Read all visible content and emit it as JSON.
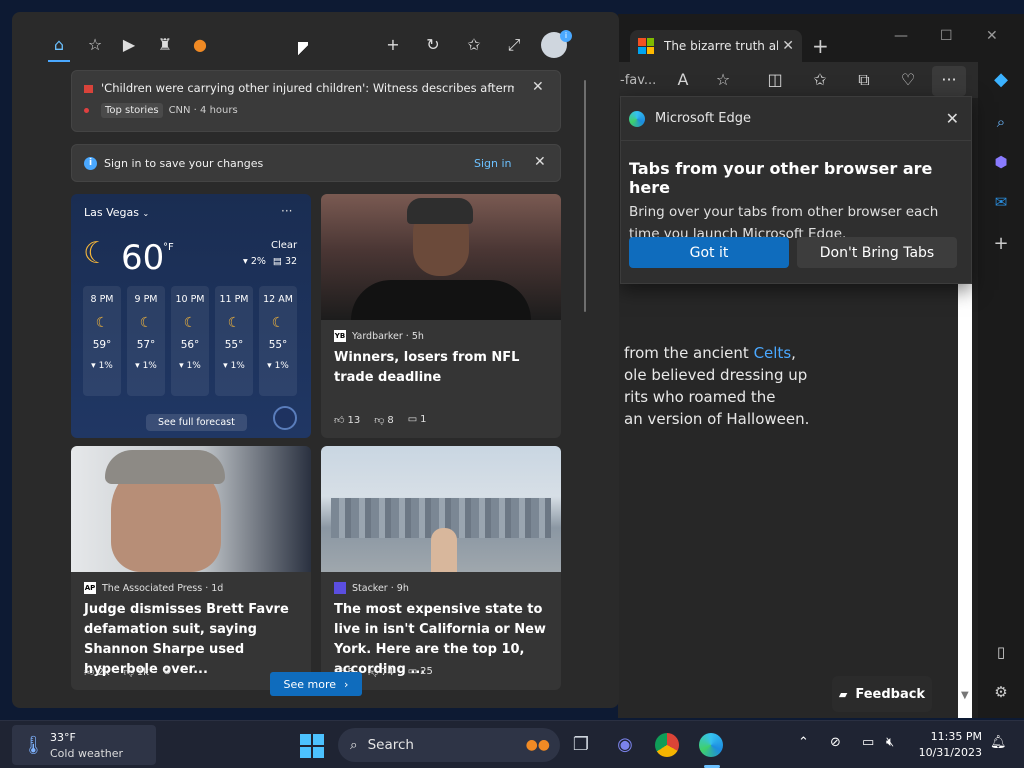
{
  "edge": {
    "tab_title": "The bizarre truth abo",
    "address_fragment": "-fav...",
    "article_lines": [
      {
        "pre": "from the ancient ",
        "link": "Celts",
        "post": ","
      },
      {
        "pre": "ole believed dressing up",
        "link": "",
        "post": ""
      },
      {
        "pre": "rits who roamed the",
        "link": "",
        "post": ""
      },
      {
        "pre": "an version of Halloween.",
        "link": "",
        "post": ""
      }
    ],
    "feedback_label": "Feedback",
    "popup": {
      "app_name": "Microsoft Edge",
      "heading": "Tabs from your other browser are here",
      "body": "Bring over your tabs from other browser each time you launch Microsoft Edge.",
      "primary_label": "Got it",
      "secondary_label": "Don't Bring Tabs"
    }
  },
  "widgets": {
    "notification": {
      "headline": "'Children were carrying other injured children': Witness describes aftermath of...",
      "category": "Top stories",
      "source_time": "CNN · 4 hours"
    },
    "signin": {
      "text": "Sign in to save your changes",
      "link": "Sign in"
    },
    "weather": {
      "city": "Las Vegas",
      "temp": "60",
      "unit": "°F",
      "condition": "Clear",
      "humidity": "2%",
      "wind": "32",
      "hours": [
        {
          "time": "8 PM",
          "temp": "59°",
          "precip": "1%"
        },
        {
          "time": "9 PM",
          "temp": "57°",
          "precip": "1%"
        },
        {
          "time": "10 PM",
          "temp": "56°",
          "precip": "1%"
        },
        {
          "time": "11 PM",
          "temp": "55°",
          "precip": "1%"
        },
        {
          "time": "12 AM",
          "temp": "55°",
          "precip": "1%"
        }
      ],
      "forecast_label": "See full forecast"
    },
    "news": [
      {
        "source_icon": "YB",
        "source": "Yardbarker · 5h",
        "headline": "Winners, losers from NFL trade deadline",
        "likes": "13",
        "dislikes": "8",
        "comments": "1"
      },
      {
        "source_icon": "AP",
        "source": "The Associated Press · 1d",
        "headline": "Judge dismisses Brett Favre defamation suit, saying Shannon Sharpe used hyperbole over...",
        "likes": "2k",
        "dislikes": "1k",
        "comments": ""
      },
      {
        "source_icon": "",
        "source": "Stacker · 9h",
        "headline": "The most expensive state to live in isn't California or New York. Here are the top 10, according ...",
        "likes": "5",
        "dislikes": "74",
        "comments": "25"
      }
    ],
    "see_more_label": "See more"
  },
  "taskbar": {
    "weather_temp": "33°F",
    "weather_desc": "Cold weather",
    "search_label": "Search",
    "time": "11:35 PM",
    "date": "10/31/2023"
  },
  "colors": {
    "accent": "#0f6cbd",
    "link": "#6cc1ff",
    "moon": "#f5b63a"
  }
}
